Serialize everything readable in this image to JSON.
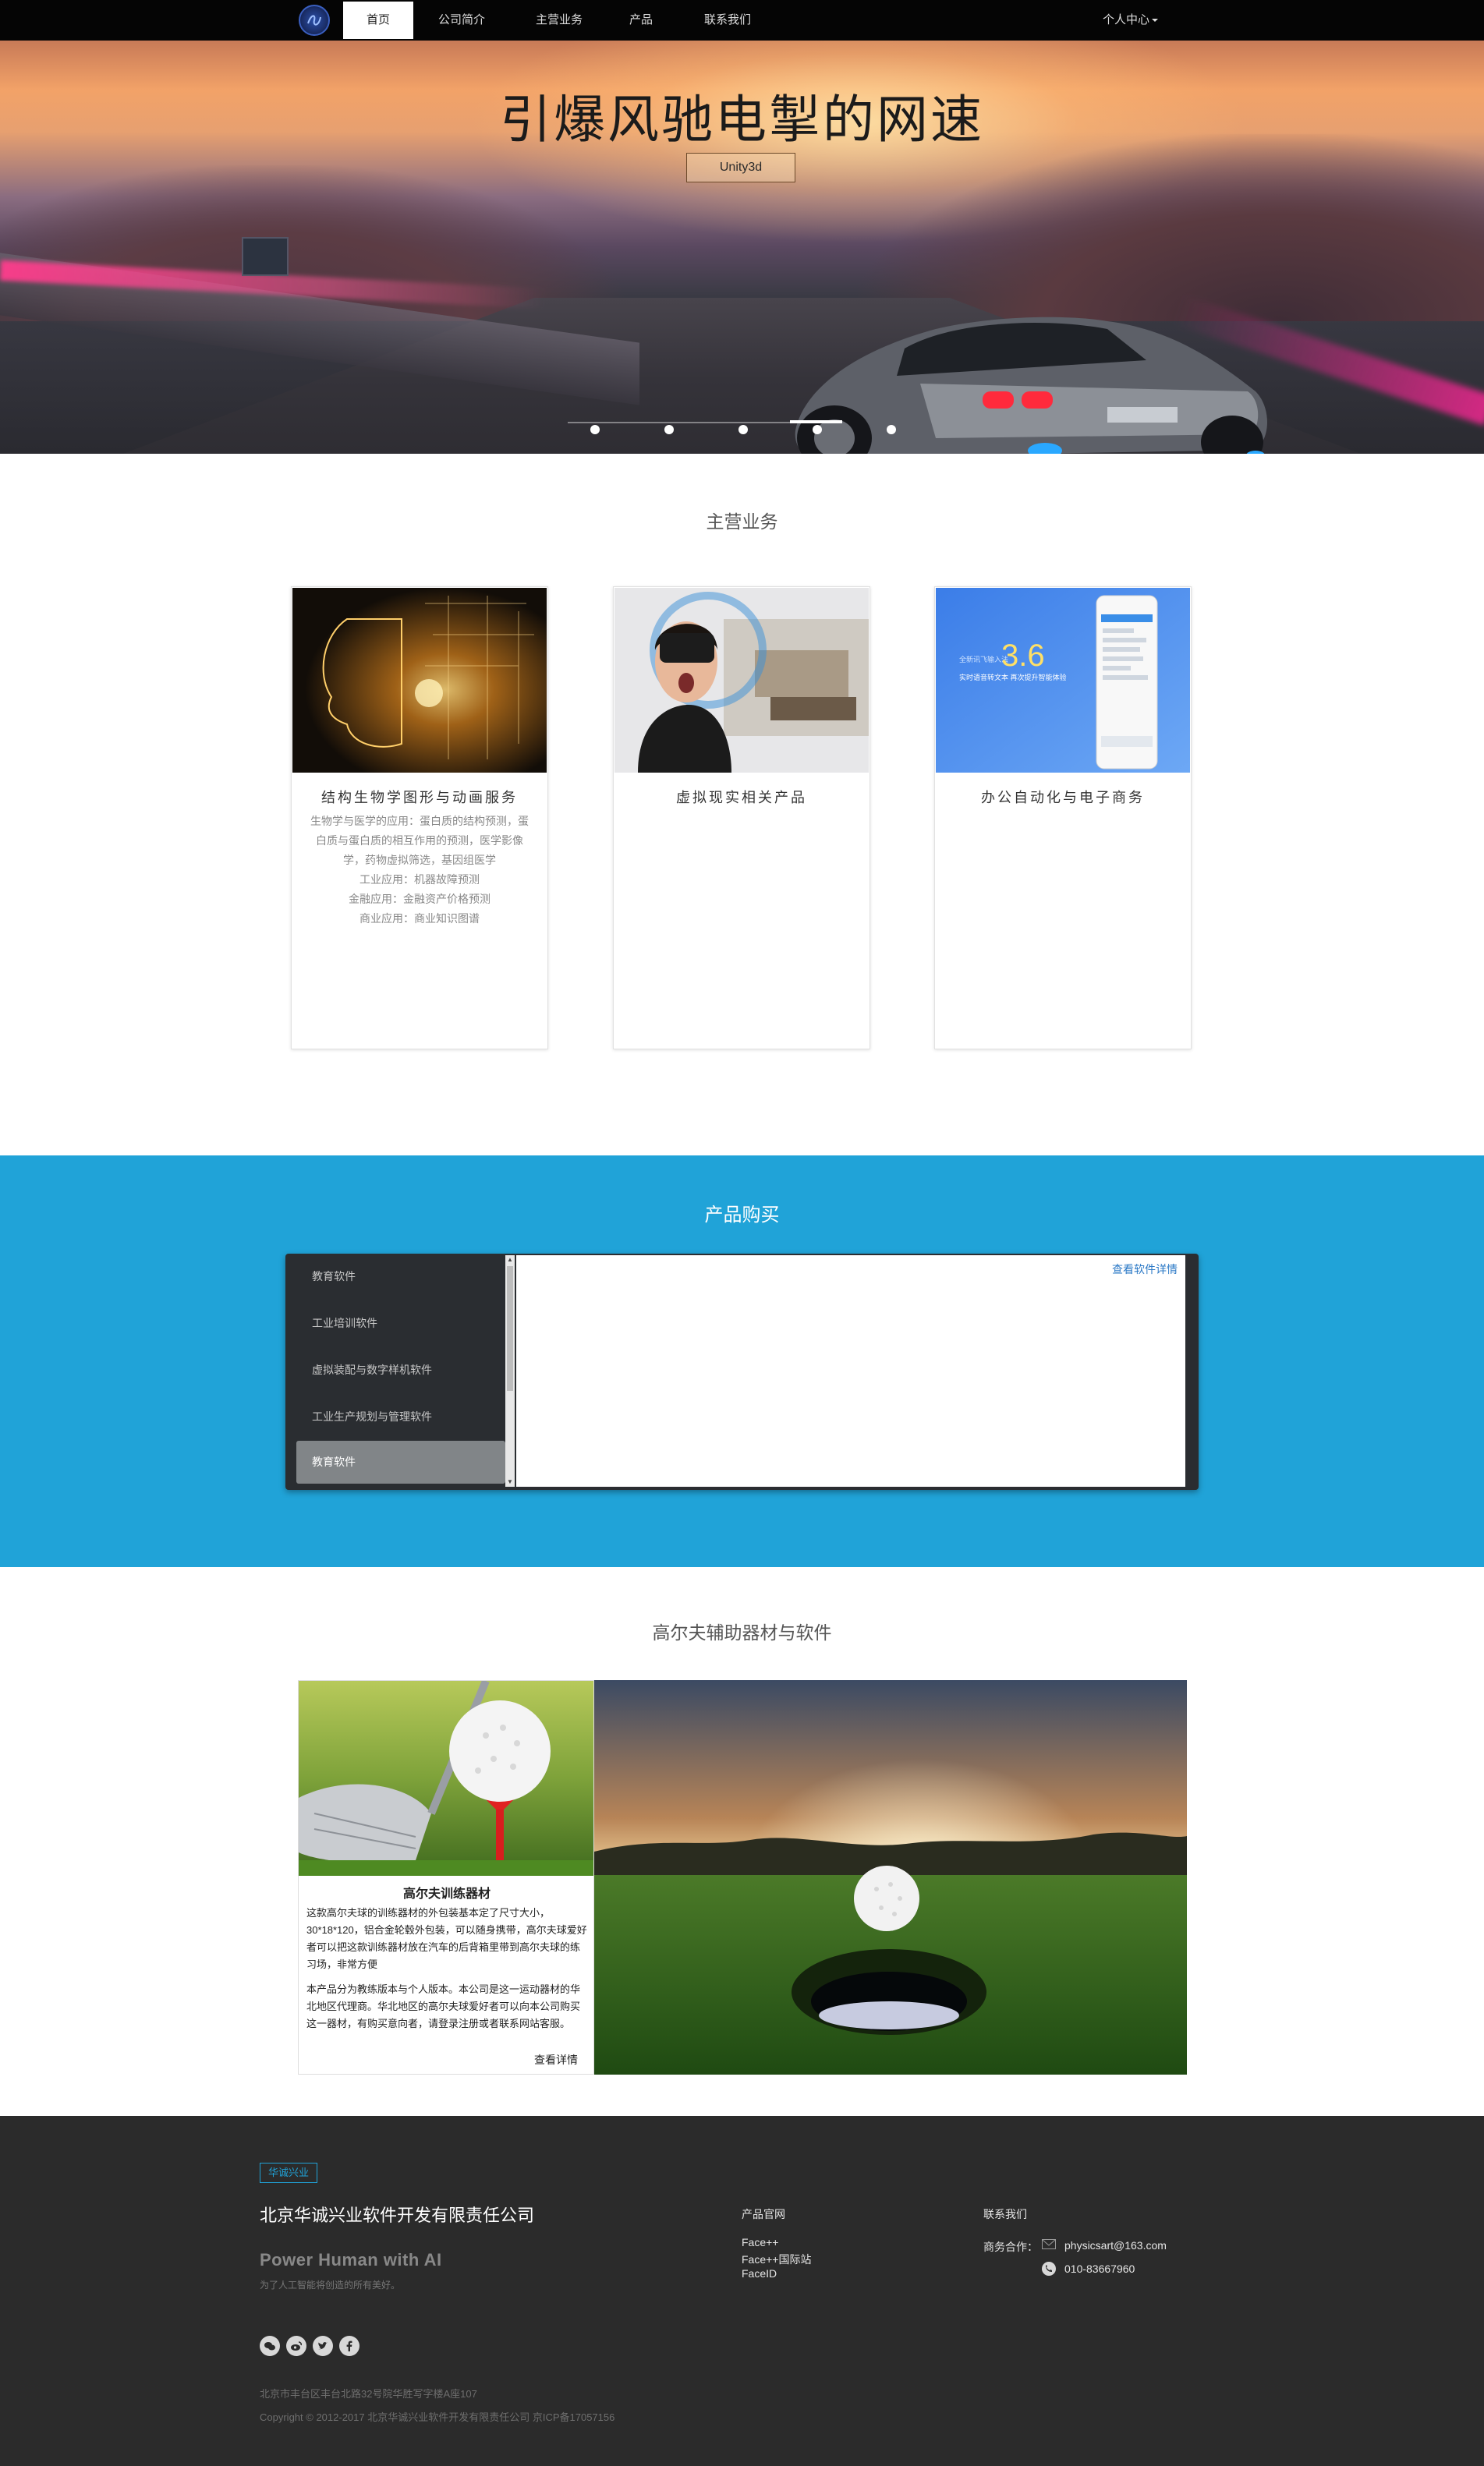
{
  "nav": {
    "items": [
      {
        "label": "首页",
        "active": true
      },
      {
        "label": "公司简介",
        "active": false
      },
      {
        "label": "主营业务",
        "active": false
      },
      {
        "label": "产品",
        "active": false
      },
      {
        "label": "联系我们",
        "active": false
      }
    ],
    "user_menu": "个人中心"
  },
  "hero": {
    "title": "引爆风驰电掣的网速",
    "button": "Unity3d",
    "slide_count": 5,
    "active_slide": 4
  },
  "business": {
    "title": "主营业务",
    "cards": [
      {
        "title": "结构生物学图形与动画服务",
        "lines": [
          "生物学与医学的应用：蛋白质的结构预测，蛋白质与蛋白质的相互作用的预测，医学影像学，药物虚拟筛选，基因组医学",
          "工业应用：机器故障预测",
          "金融应用：金融资产价格预测",
          "商业应用：商业知识图谱"
        ]
      },
      {
        "title": "虚拟现实相关产品",
        "lines": []
      },
      {
        "title": "办公自动化与电子商务",
        "lines": [],
        "screen_number": "3.6",
        "screen_caption": "实时语音转文本 再次提升智能体验"
      }
    ]
  },
  "purchase": {
    "title": "产品购买",
    "menu": [
      "教育软件",
      "工业培训软件",
      "虚拟装配与数字样机软件",
      "工业生产规划与管理软件",
      "教育软件"
    ],
    "selected_index": 4,
    "detail_link": "查看软件详情",
    "colors": {
      "band": "#20a3d8",
      "panel": "#2a2d31",
      "selected": "#818588"
    }
  },
  "golf": {
    "title": "高尔夫辅助器材与软件",
    "card_title": "高尔夫训练器材",
    "para1": "这款高尔夫球的训练器材的外包装基本定了尺寸大小，30*18*120，铝合金轮毂外包装，可以随身携带，高尔夫球爱好者可以把这款训练器材放在汽车的后背箱里带到高尔夫球的练习场，非常方便",
    "para2": "本产品分为教练版本与个人版本。本公司是这一运动器材的华北地区代理商。华北地区的高尔夫球爱好者可以向本公司购买这一器材，有购买意向者，请登录注册或者联系网站客服。",
    "more": "查看详情"
  },
  "footer": {
    "badge": "华诚兴业",
    "company": "北京华诚兴业软件开发有限责任公司",
    "slogan": "Power Human with AI",
    "slogan_sub": "为了人工智能将创造的所有美好。",
    "links_title": "产品官网",
    "links": [
      "Face++",
      "Face++国际站",
      "FaceID"
    ],
    "contact_title": "联系我们",
    "contact_label": "商务合作：",
    "email": "physicsart@163.com",
    "phone": "010-83667960",
    "social_icons": [
      "wechat-icon",
      "weibo-icon",
      "twitter-icon",
      "facebook-icon"
    ],
    "address": "北京市丰台区丰台北路32号院华胜写字楼A座107",
    "copyright": "Copyright © 2012-2017 北京华诚兴业软件开发有限责任公司 京ICP备17057156"
  }
}
